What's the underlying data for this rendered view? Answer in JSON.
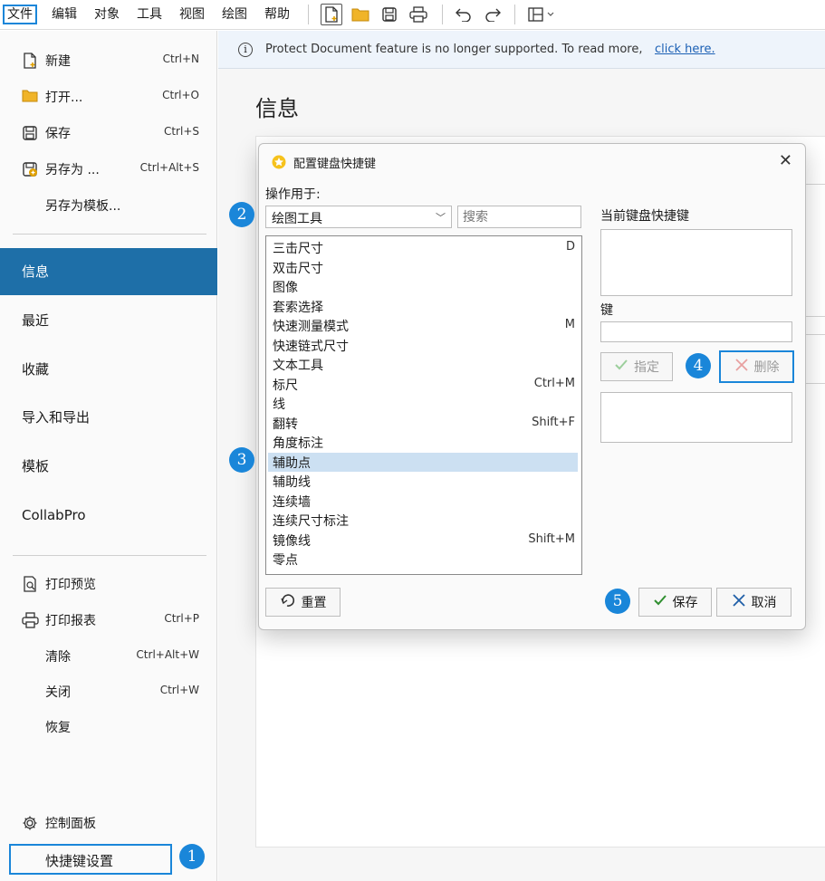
{
  "menubar": {
    "items": [
      "文件",
      "编辑",
      "对象",
      "工具",
      "视图",
      "绘图",
      "帮助"
    ]
  },
  "toolbar": {
    "icons": [
      "new-document-icon",
      "open-folder-icon",
      "save-icon",
      "print-icon",
      "undo-icon",
      "redo-icon",
      "layout-icon"
    ]
  },
  "left_pane": {
    "commands": [
      {
        "label": "新建",
        "shortcut": "Ctrl+N",
        "icon": "new-document-icon"
      },
      {
        "label": "打开...",
        "shortcut": "Ctrl+O",
        "icon": "open-folder-icon"
      },
      {
        "label": "保存",
        "shortcut": "Ctrl+S",
        "icon": "save-icon"
      },
      {
        "label": "另存为 ...",
        "shortcut": "Ctrl+Alt+S",
        "icon": "save-as-icon"
      },
      {
        "label": "另存为模板...",
        "shortcut": "",
        "icon": ""
      }
    ],
    "nav": [
      {
        "label": "信息",
        "selected": true
      },
      {
        "label": "最近",
        "selected": false
      },
      {
        "label": "收藏",
        "selected": false
      },
      {
        "label": "导入和导出",
        "selected": false
      },
      {
        "label": "模板",
        "selected": false
      },
      {
        "label": "CollabPro",
        "selected": false
      }
    ],
    "print_commands": [
      {
        "label": "打印预览",
        "shortcut": "",
        "icon": "print-preview-icon"
      },
      {
        "label": "打印报表",
        "shortcut": "Ctrl+P",
        "icon": "print-icon"
      },
      {
        "label": "清除",
        "shortcut": "Ctrl+Alt+W",
        "icon": ""
      },
      {
        "label": "关闭",
        "shortcut": "Ctrl+W",
        "icon": ""
      },
      {
        "label": "恢复",
        "shortcut": "",
        "icon": ""
      }
    ],
    "control_panel": "控制面板",
    "shortcut_settings": "快捷键设置"
  },
  "notice": {
    "message": "Protect Document feature is no longer supported. To read more,",
    "link": "click here."
  },
  "page_title": "信息",
  "dialog": {
    "title": "配置键盘快捷键",
    "operation_label": "操作用于:",
    "operation_value": "绘图工具",
    "search_placeholder": "搜索",
    "current_shortcut_label": "当前键盘快捷键",
    "key_label": "键",
    "assign_label": "指定",
    "delete_label": "删除",
    "reset_label": "重置",
    "save_label": "保存",
    "cancel_label": "取消",
    "commands": [
      {
        "name": "三击尺寸",
        "key": "D"
      },
      {
        "name": "双击尺寸",
        "key": ""
      },
      {
        "name": "图像",
        "key": ""
      },
      {
        "name": "套索选择",
        "key": ""
      },
      {
        "name": "快速测量模式",
        "key": "M"
      },
      {
        "name": "快速链式尺寸",
        "key": ""
      },
      {
        "name": "文本工具",
        "key": ""
      },
      {
        "name": "标尺",
        "key": "Ctrl+M"
      },
      {
        "name": "线",
        "key": ""
      },
      {
        "name": "翻转",
        "key": "Shift+F"
      },
      {
        "name": "角度标注",
        "key": ""
      },
      {
        "name": "辅助点",
        "key": "",
        "selected": true
      },
      {
        "name": "辅助线",
        "key": ""
      },
      {
        "name": "连续墙",
        "key": ""
      },
      {
        "name": "连续尺寸标注",
        "key": ""
      },
      {
        "name": "镜像线",
        "key": "Shift+M"
      },
      {
        "name": "零点",
        "key": ""
      }
    ]
  },
  "badges": [
    "1",
    "2",
    "3",
    "4",
    "5"
  ],
  "colors": {
    "accent": "#1a86d9",
    "nav_selected": "#1e6fa8",
    "list_selected": "#cce0f2"
  }
}
